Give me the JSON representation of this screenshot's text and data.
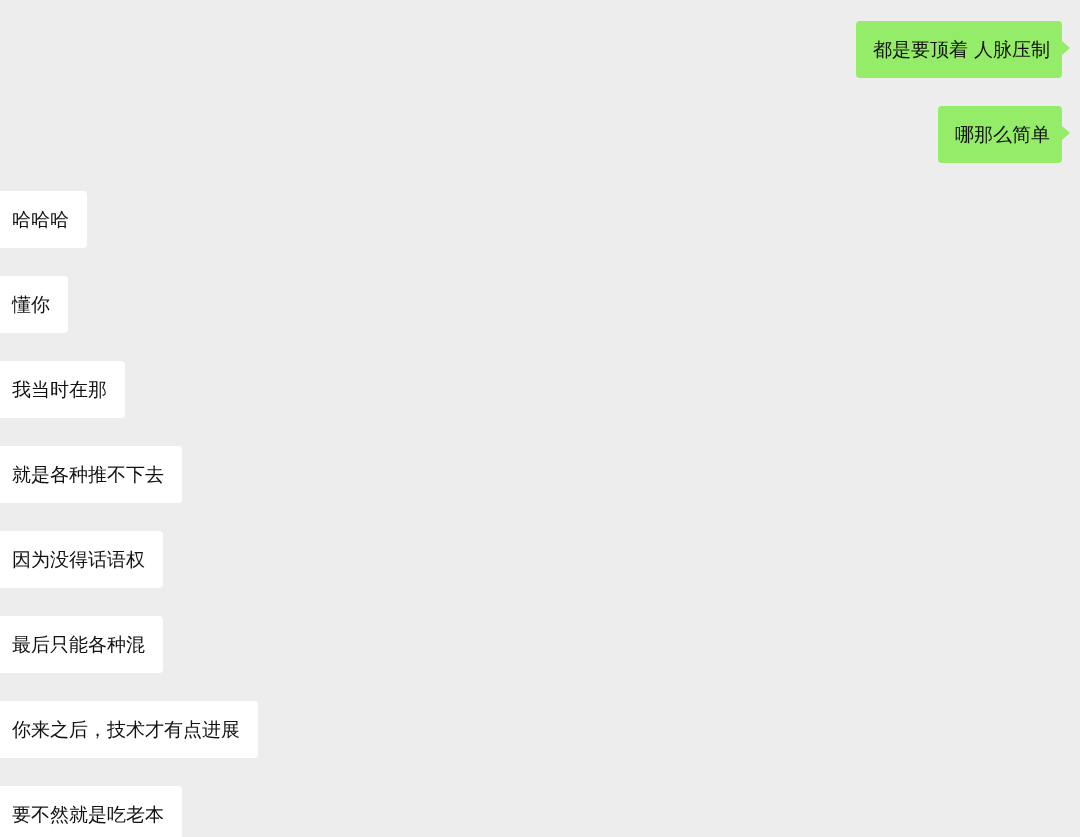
{
  "messages": [
    {
      "kind": "outgoing",
      "text": "都是要顶着 人脉压制"
    },
    {
      "kind": "outgoing",
      "text": "哪那么简单"
    },
    {
      "kind": "incoming",
      "text": "哈哈哈"
    },
    {
      "kind": "incoming",
      "text": "懂你"
    },
    {
      "kind": "incoming",
      "text": "我当时在那"
    },
    {
      "kind": "incoming",
      "text": "就是各种推不下去"
    },
    {
      "kind": "incoming",
      "text": "因为没得话语权"
    },
    {
      "kind": "incoming",
      "text": "最后只能各种混"
    },
    {
      "kind": "incoming",
      "text": "你来之后，技术才有点进展"
    },
    {
      "kind": "incoming",
      "text": "要不然就是吃老本"
    }
  ]
}
